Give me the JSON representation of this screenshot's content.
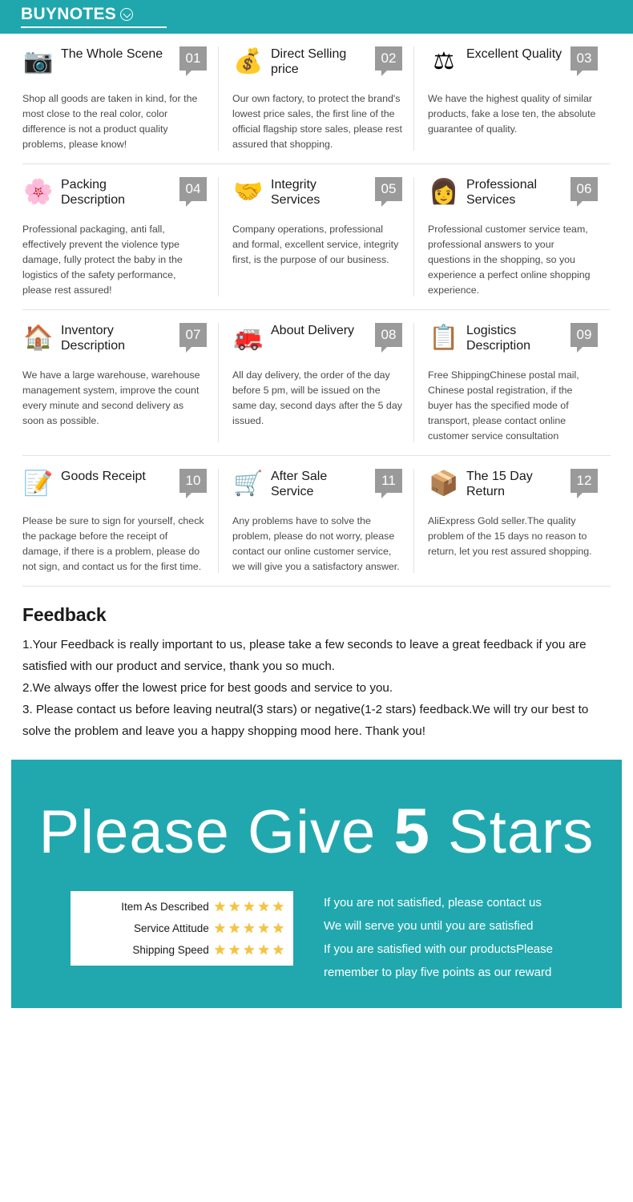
{
  "header": {
    "brand": "BUYNOTES",
    "chevron_icon": "chevron-down-circle-icon",
    "bg_color": "#1fa7ad"
  },
  "notes": {
    "cards": [
      {
        "number": "01",
        "title": "The Whole Scene",
        "body": "Shop all goods are taken in kind, for the most close to the real color, color difference is not a product quality problems, please know!",
        "icon": "camera-icon",
        "glyph": "📷"
      },
      {
        "number": "02",
        "title": "Direct Selling price",
        "body": "Our own factory, to protect the brand's lowest price sales, the first line of the official flagship store sales, please rest assured that shopping.",
        "icon": "money-bags-icon",
        "glyph": "💰"
      },
      {
        "number": "03",
        "title": "Excellent Quality",
        "body": "We have the highest quality of similar products, fake a lose ten, the absolute guarantee of quality.",
        "icon": "balance-scales-icon",
        "glyph": "⚖"
      },
      {
        "number": "04",
        "title": "Packing Description",
        "body": "Professional packaging, anti fall, effectively prevent the violence type damage, fully protect the baby in the logistics of the safety performance, please rest assured!",
        "icon": "color-pinwheel-icon",
        "glyph": "🌸"
      },
      {
        "number": "05",
        "title": "Integrity Services",
        "body": "Company operations, professional and formal, excellent service, integrity first, is the purpose of our business.",
        "icon": "handshake-icon",
        "glyph": "🤝"
      },
      {
        "number": "06",
        "title": "Professional Services",
        "body": "Professional customer service team, professional answers to your questions in the shopping, so you experience a perfect online shopping experience.",
        "icon": "customer-service-agent-icon",
        "glyph": "👩"
      },
      {
        "number": "07",
        "title": "Inventory Description",
        "body": "We have a large warehouse, warehouse management system, improve the count every minute and second delivery as soon as possible.",
        "icon": "warehouse-house-icon",
        "glyph": "🏠"
      },
      {
        "number": "08",
        "title": "About Delivery",
        "body": "All day delivery, the order of the day before 5 pm, will be issued on the same day, second days after the 5 day issued.",
        "icon": "delivery-truck-icon",
        "glyph": "🚒"
      },
      {
        "number": "09",
        "title": "Logistics Description",
        "body": "Free ShippingChinese postal mail, Chinese postal registration, if the buyer has the specified mode of transport, please contact online customer service consultation",
        "icon": "clipboard-pen-icon",
        "glyph": "📋"
      },
      {
        "number": "10",
        "title": "Goods Receipt",
        "body": "Please be sure to sign for yourself, check the package before the receipt of damage, if there is a problem, please do not sign, and contact us for the first time.",
        "icon": "receipt-checkmark-icon",
        "glyph": "📝"
      },
      {
        "number": "11",
        "title": "After Sale Service",
        "body": "Any problems have to solve the problem, please do not worry, please contact our online customer service, we will give you a satisfactory answer.",
        "icon": "shopping-cart-return-icon",
        "glyph": "🛒"
      },
      {
        "number": "12",
        "title": "The 15 Day Return",
        "body": "AliExpress Gold seller.The quality problem of the 15 days no reason to return, let you rest assured shopping.",
        "icon": "open-box-icon",
        "glyph": "📦"
      }
    ]
  },
  "feedback": {
    "heading": "Feedback",
    "line1": "1.Your Feedback is really important to us, please take a few seconds to leave a great feedback if you are satisfied with our product and service, thank you so much.",
    "line2": "2.We always offer the lowest price for best goods and service to you.",
    "line3": "3. Please contact us before leaving neutral(3 stars) or negative(1-2 stars) feedback.We will try our best to solve the problem and leave you a happy shopping mood here. Thank you!"
  },
  "stars_banner": {
    "headline_pre": "Please Give ",
    "headline_number": "5",
    "headline_post": " Stars",
    "bg_color": "#21a8ae",
    "ratings": [
      {
        "label": "Item As Described",
        "stars": 5
      },
      {
        "label": "Service Attitude",
        "stars": 5
      },
      {
        "label": "Shipping Speed",
        "stars": 5
      }
    ],
    "star_glyph": "★",
    "star_color": "#f6c33c",
    "messages": [
      "If you are not satisfied, please contact us",
      "We will serve you until you are satisfied",
      "If you are satisfied with our productsPlease",
      "remember to play five points as our reward"
    ]
  }
}
